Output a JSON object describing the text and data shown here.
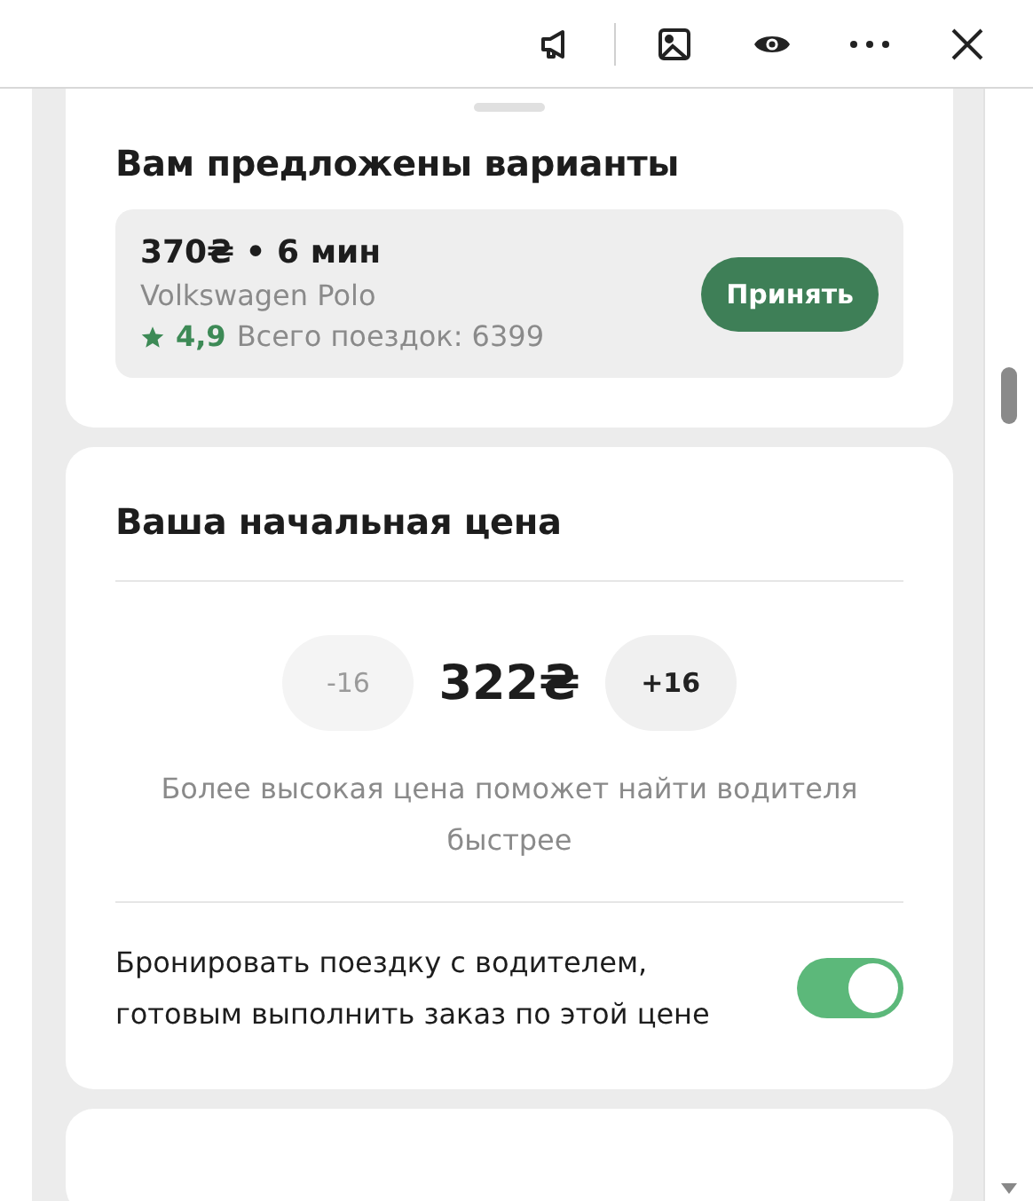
{
  "offers": {
    "title": "Вам предложены варианты",
    "items": [
      {
        "price_time": "370₴ • 6 мин",
        "car": "Volkswagen Polo",
        "rating": "4,9",
        "trips": "Всего поездок: 6399",
        "button": "Принять"
      }
    ]
  },
  "price": {
    "title": "Ваша начальная цена",
    "decrease": {
      "label": "-16",
      "disabled": true
    },
    "value": "322₴",
    "increase": {
      "label": "+16",
      "disabled": false
    },
    "hint": "Более высокая цена поможет найти водителя быстрее",
    "booking": {
      "label": "Бронировать поездку с водителем, готовым выполнить заказ по этой цене",
      "on": true
    }
  }
}
